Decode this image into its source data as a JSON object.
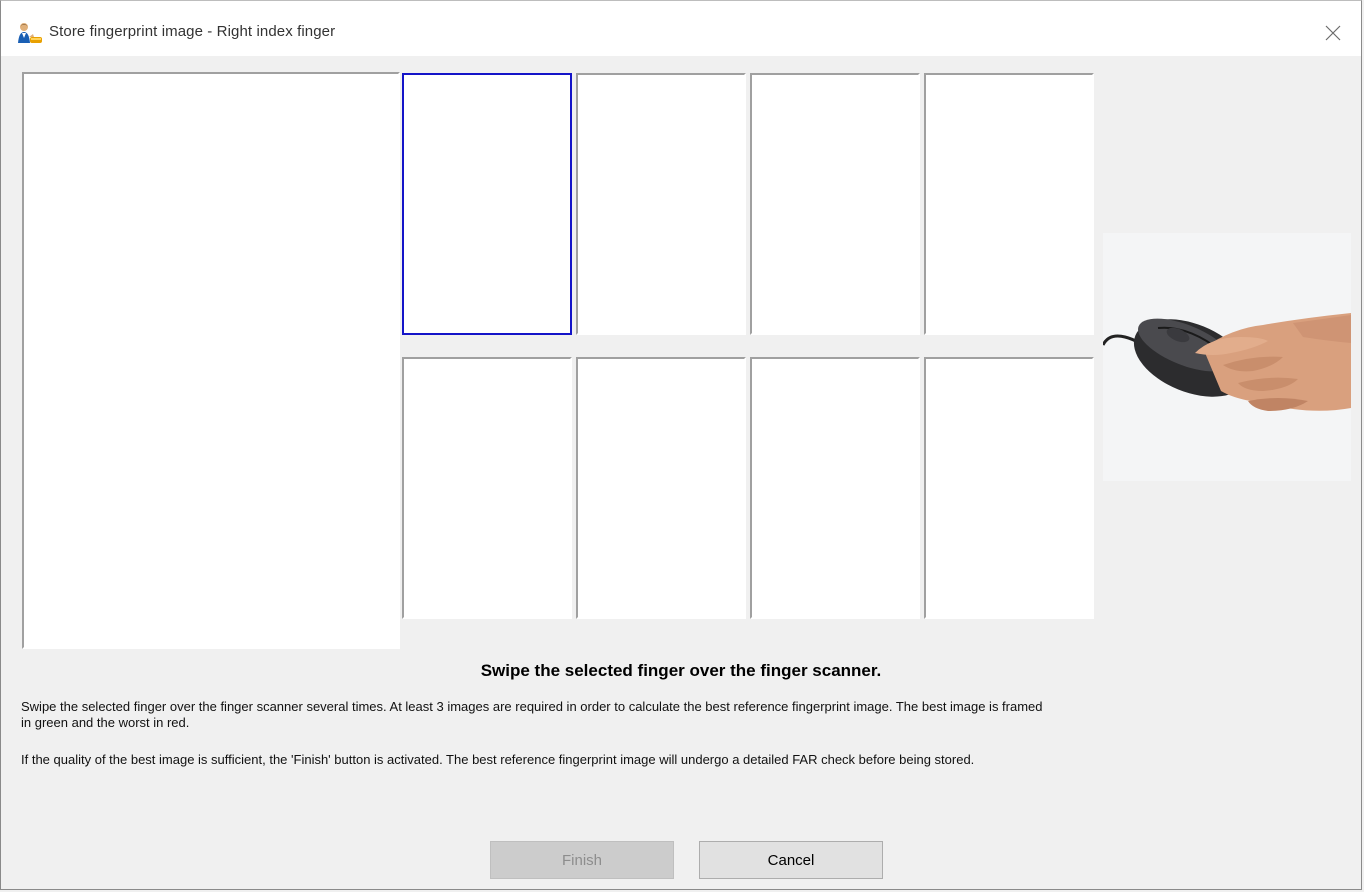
{
  "window": {
    "title": "Store fingerprint image - Right index finger",
    "icon": "user-fingerprint-icon",
    "close_icon": "close-icon"
  },
  "thumbnails": {
    "rows": 2,
    "columns": 4,
    "selected_index": 0,
    "selected_color": "#1414c8"
  },
  "instructions": {
    "heading": "Swipe the selected finger over the finger scanner.",
    "paragraph1_line1": "Swipe the selected finger over the finger scanner several times. At least 3 images are required in order to calculate the best reference fingerprint image. The best image is framed",
    "paragraph1_line2": "in green and the worst in red.",
    "paragraph2": "If the quality of the best image is sufficient, the 'Finish' button is activated. The best reference fingerprint image will undergo a detailed FAR check before being stored."
  },
  "illustration": "hand-on-fingerprint-scanner-image",
  "buttons": {
    "finish_label": "Finish",
    "finish_enabled": false,
    "cancel_label": "Cancel"
  }
}
